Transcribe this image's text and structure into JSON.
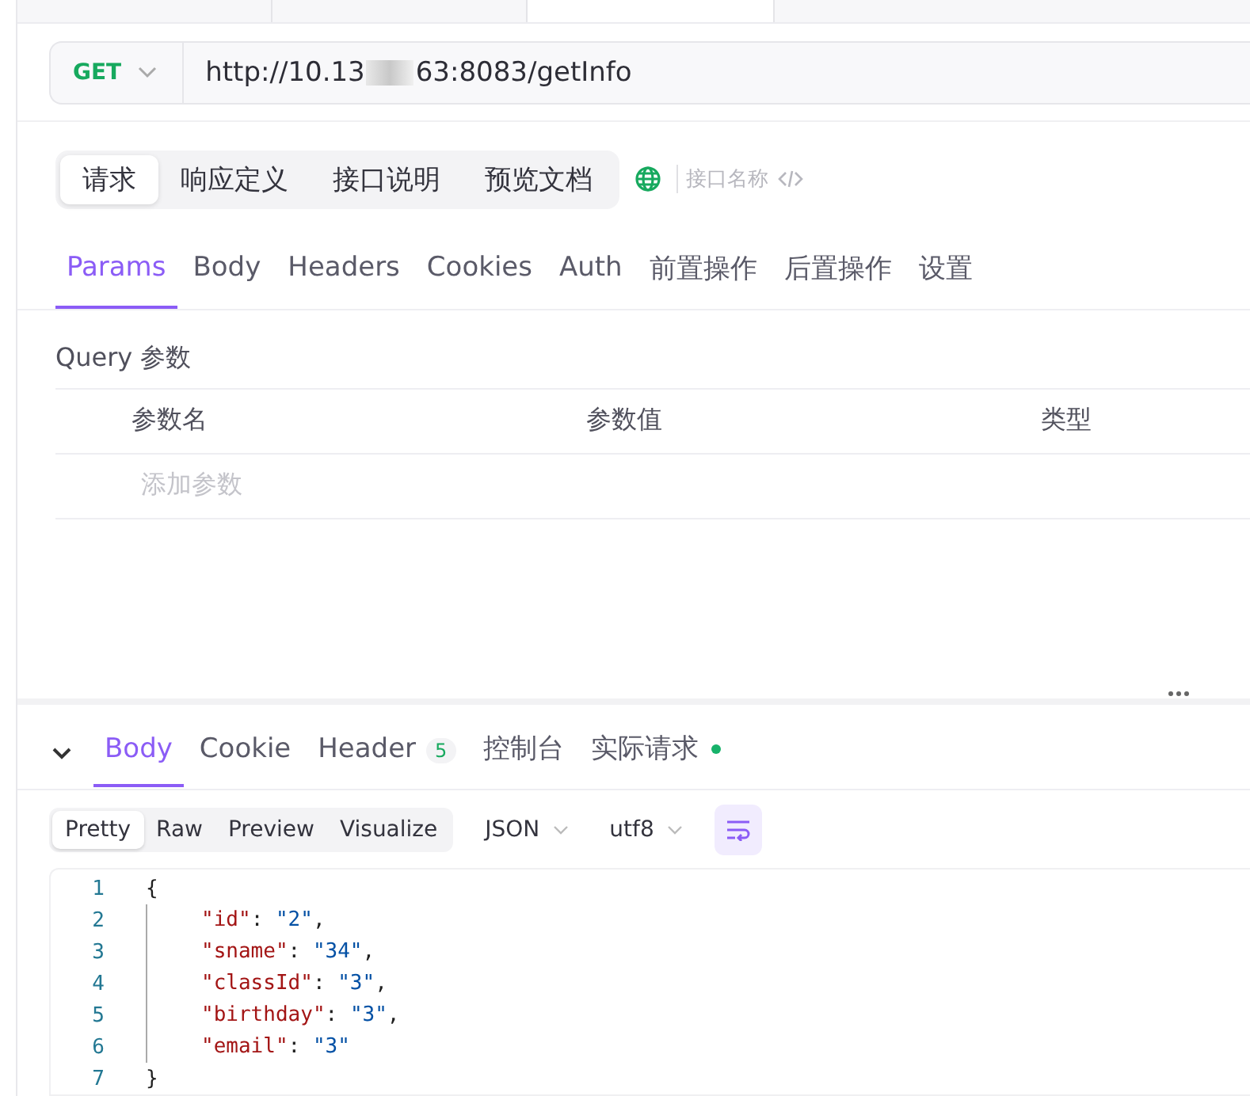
{
  "top_tabs": [
    {
      "selected": false
    },
    {
      "selected": false
    },
    {
      "selected": true
    }
  ],
  "request": {
    "method": "GET",
    "url_start": "http://10.13",
    "url_end": "63:8083/getInfo"
  },
  "modes": [
    {
      "label": "请求",
      "selected": true
    },
    {
      "label": "响应定义",
      "selected": false
    },
    {
      "label": "接口说明",
      "selected": false
    },
    {
      "label": "预览文档",
      "selected": false
    }
  ],
  "name_field": {
    "placeholder": "接口名称"
  },
  "request_tabs": [
    {
      "label": "Params",
      "selected": true
    },
    {
      "label": "Body",
      "selected": false
    },
    {
      "label": "Headers",
      "selected": false
    },
    {
      "label": "Cookies",
      "selected": false
    },
    {
      "label": "Auth",
      "selected": false
    },
    {
      "label": "前置操作",
      "selected": false
    },
    {
      "label": "后置操作",
      "selected": false
    },
    {
      "label": "设置",
      "selected": false
    }
  ],
  "query": {
    "title": "Query 参数",
    "columns": [
      "参数名",
      "参数值",
      "类型"
    ],
    "add_placeholder": "添加参数"
  },
  "response_tabs": [
    {
      "label": "Body",
      "selected": true
    },
    {
      "label": "Cookie",
      "selected": false
    },
    {
      "label": "Header",
      "selected": false,
      "count": "5"
    },
    {
      "label": "控制台",
      "selected": false
    },
    {
      "label": "实际请求",
      "selected": false,
      "dot": true
    }
  ],
  "views": [
    {
      "label": "Pretty",
      "selected": true
    },
    {
      "label": "Raw",
      "selected": false
    },
    {
      "label": "Preview",
      "selected": false
    },
    {
      "label": "Visualize",
      "selected": false
    }
  ],
  "format": "JSON",
  "encoding": "utf8",
  "code": [
    {
      "number": "1",
      "tokens": [
        {
          "kind": "punct",
          "text": "{"
        }
      ]
    },
    {
      "number": "2",
      "tokens": [
        {
          "kind": "key",
          "text": "\"id\""
        },
        {
          "kind": "punct",
          "text": ": "
        },
        {
          "kind": "string",
          "text": "\"2\""
        },
        {
          "kind": "punct",
          "text": ","
        }
      ]
    },
    {
      "number": "3",
      "tokens": [
        {
          "kind": "key",
          "text": "\"sname\""
        },
        {
          "kind": "punct",
          "text": ": "
        },
        {
          "kind": "string",
          "text": "\"34\""
        },
        {
          "kind": "punct",
          "text": ","
        }
      ]
    },
    {
      "number": "4",
      "tokens": [
        {
          "kind": "key",
          "text": "\"classId\""
        },
        {
          "kind": "punct",
          "text": ": "
        },
        {
          "kind": "string",
          "text": "\"3\""
        },
        {
          "kind": "punct",
          "text": ","
        }
      ]
    },
    {
      "number": "5",
      "tokens": [
        {
          "kind": "key",
          "text": "\"birthday\""
        },
        {
          "kind": "punct",
          "text": ": "
        },
        {
          "kind": "string",
          "text": "\"3\""
        },
        {
          "kind": "punct",
          "text": ","
        }
      ]
    },
    {
      "number": "6",
      "tokens": [
        {
          "kind": "key",
          "text": "\"email\""
        },
        {
          "kind": "punct",
          "text": ": "
        },
        {
          "kind": "string",
          "text": "\"3\""
        }
      ]
    },
    {
      "number": "7",
      "tokens": [
        {
          "kind": "punct",
          "text": "}"
        }
      ]
    }
  ]
}
